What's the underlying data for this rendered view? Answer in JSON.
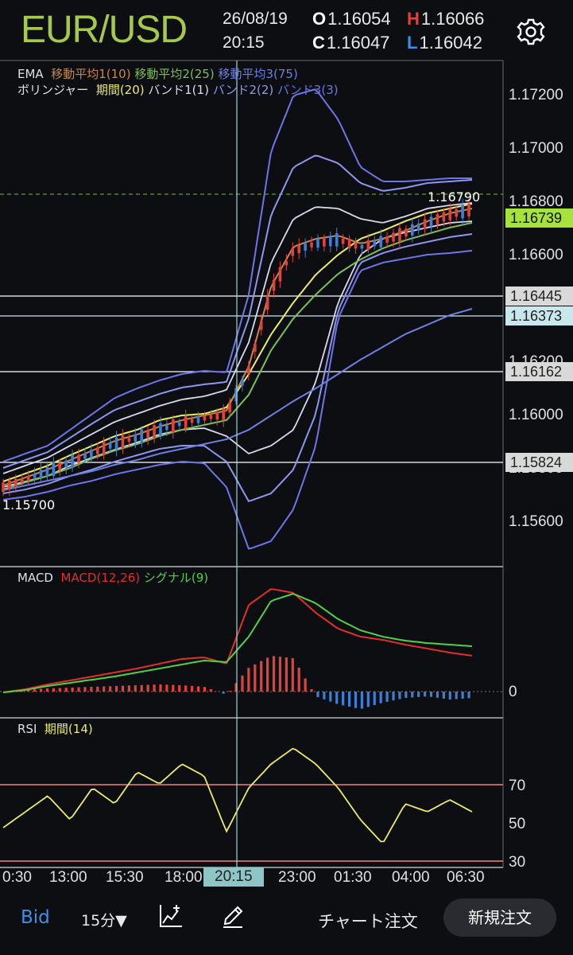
{
  "header": {
    "pair": "EUR/USD",
    "date": "26/08/19",
    "time": "20:15",
    "open_label": "O",
    "open": "1.16054",
    "high_label": "H",
    "high": "1.16066",
    "close_label": "C",
    "close": "1.16047",
    "low_label": "L",
    "low": "1.16042",
    "settings_icon": "gear-icon"
  },
  "legend": {
    "ema_title": "EMA",
    "ema1": "移動平均1(10)",
    "ema2": "移動平均2(25)",
    "ema3": "移動平均3(75)",
    "bb_title": "ボリンジャー",
    "bb_period": "期間(20)",
    "bb_band1": "バンド1(1)",
    "bb_band2": "バンド2(2)",
    "bb_band3": "バンド3(3)",
    "macd_title": "MACD",
    "macd_line": "MACD(12,26)",
    "macd_signal": "シグナル(9)",
    "rsi_title": "RSI",
    "rsi_period": "期間(14)"
  },
  "price_axis": [
    "1.17200",
    "1.17000",
    "1.16800",
    "1.16600",
    "1.16200",
    "1.16000",
    "1.15800",
    "1.15600"
  ],
  "price_tags": {
    "current": "1.16739",
    "level1": "1.16445",
    "level2": "1.16373",
    "level3": "1.16162",
    "level4": "1.15824"
  },
  "annotations": {
    "high_mark": "1.16790",
    "low_mark": "1.15700"
  },
  "macd_axis": "0",
  "rsi_axis": [
    "70",
    "50",
    "30"
  ],
  "time_axis": [
    "0:30",
    "13:00",
    "15:30",
    "18:00",
    "20:15",
    "23:00",
    "01:30",
    "04:00",
    "06:30"
  ],
  "toolbar": {
    "bid": "Bid",
    "interval": "15分▼",
    "chart_order": "チャート注文",
    "new_order": "新規注文"
  },
  "colors": {
    "pair": "#a7c94b",
    "bull": "#e5413b",
    "bear": "#3d7fd6",
    "ema1": "#c8864f",
    "ema2": "#7cbf58",
    "ema3": "#6f7fe0",
    "bb_mid": "#ecec66",
    "macd": "#e0302a",
    "signal": "#52d04a",
    "rsi": "#ecec66",
    "current_tag": "#a6e23c"
  }
}
